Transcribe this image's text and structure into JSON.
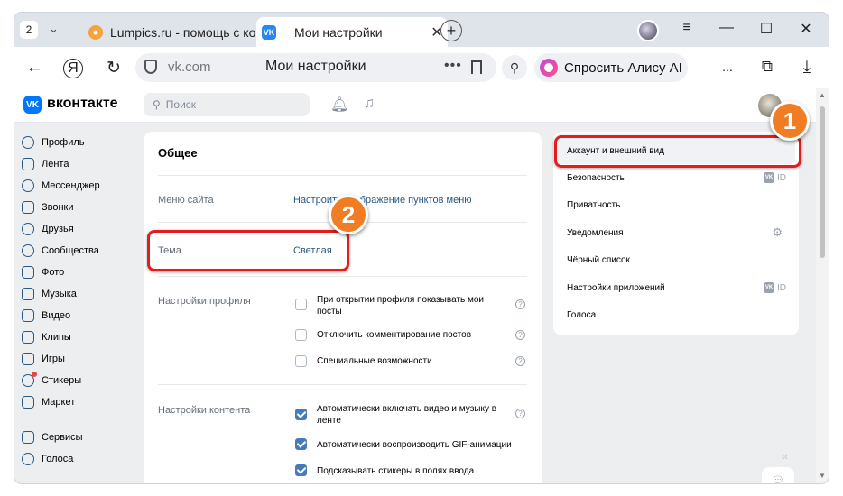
{
  "browser": {
    "tab_count": "2",
    "tabs": [
      {
        "title": "Lumpics.ru - помощь с ком"
      },
      {
        "title": "Мои настройки"
      }
    ],
    "address": {
      "domain": "vk.com",
      "page_title": "Мои настройки",
      "dots": "•••"
    },
    "alice_label": "Спросить Алису AI",
    "more_label": "..."
  },
  "vk": {
    "logo_text": "вконтакте",
    "search_placeholder": "Поиск",
    "left_menu": [
      "Профиль",
      "Лента",
      "Мессенджер",
      "Звонки",
      "Друзья",
      "Сообщества",
      "Фото",
      "Музыка",
      "Видео",
      "Клипы",
      "Игры",
      "Стикеры",
      "Маркет",
      "Сервисы",
      "Голоса"
    ],
    "main": {
      "title": "Общее",
      "site_menu_label": "Меню сайта",
      "site_menu_value": "Настроить отображение пунктов меню",
      "theme_label": "Тема",
      "theme_value": "Светлая",
      "profile_label": "Настройки профиля",
      "profile_options": [
        {
          "text": "При открытии профиля показывать мои посты",
          "checked": false
        },
        {
          "text": "Отключить комментирование постов",
          "checked": false
        },
        {
          "text": "Специальные возможности",
          "checked": false
        }
      ],
      "content_label": "Настройки контента",
      "content_options": [
        {
          "text": "Автоматически включать видео и музыку в ленте",
          "checked": true
        },
        {
          "text": "Автоматически воспроизводить GIF-анимации",
          "checked": true
        },
        {
          "text": "Подсказывать стикеры в полях ввода",
          "checked": true
        }
      ],
      "help_mark": "?"
    },
    "right_menu": [
      {
        "label": "Аккаунт и внешний вид",
        "active": true
      },
      {
        "label": "Безопасность",
        "tag": "ID"
      },
      {
        "label": "Приватность"
      },
      {
        "label": "Уведомления",
        "icon": "gear-icon"
      },
      {
        "label": "Чёрный список"
      },
      {
        "label": "Настройки приложений",
        "tag": "ID"
      },
      {
        "label": "Голоса"
      }
    ]
  },
  "annotations": {
    "one": "1",
    "two": "2",
    "color": "#e51c1c",
    "badge_color": "#f07d24"
  }
}
